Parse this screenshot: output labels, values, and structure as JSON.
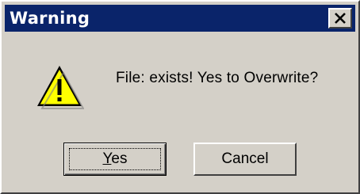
{
  "window": {
    "title": "Warning",
    "close_icon": "close-x-icon",
    "titlebar_color": "#0a246a",
    "body_color": "#d4d0c8"
  },
  "content": {
    "icon": "warning-triangle-icon",
    "message": "File:  exists! Yes to Overwrite?"
  },
  "buttons": {
    "yes": {
      "mnemonic": "Y",
      "rest": "es",
      "focused": true
    },
    "cancel": {
      "label": "Cancel"
    }
  }
}
